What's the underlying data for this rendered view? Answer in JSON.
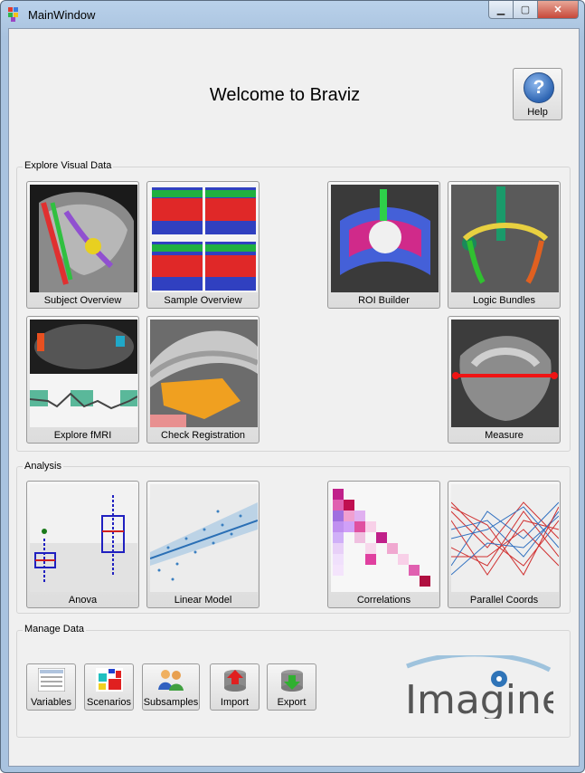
{
  "window": {
    "title": "MainWindow",
    "controls": {
      "minimize": "▁",
      "maximize": "▢",
      "close": "✕"
    }
  },
  "header": {
    "welcome": "Welcome to Braviz",
    "help_label": "Help",
    "help_symbol": "?"
  },
  "sections": {
    "explore": {
      "title": "Explore Visual Data",
      "tiles": {
        "subject_overview": "Subject Overview",
        "sample_overview": "Sample Overview",
        "roi_builder": "ROI Builder",
        "logic_bundles": "Logic Bundles",
        "explore_fmri": "Explore fMRI",
        "check_registration": "Check Registration",
        "measure": "Measure"
      }
    },
    "analysis": {
      "title": "Analysis",
      "tiles": {
        "anova": "Anova",
        "linear_model": "Linear Model",
        "correlations": "Correlations",
        "parallel_coords": "Parallel Coords"
      }
    },
    "manage": {
      "title": "Manage Data",
      "buttons": {
        "variables": "Variables",
        "scenarios": "Scenarios",
        "subsamples": "Subsamples",
        "import": "Import",
        "export": "Export"
      }
    }
  },
  "logo": {
    "text": "Imagine"
  }
}
